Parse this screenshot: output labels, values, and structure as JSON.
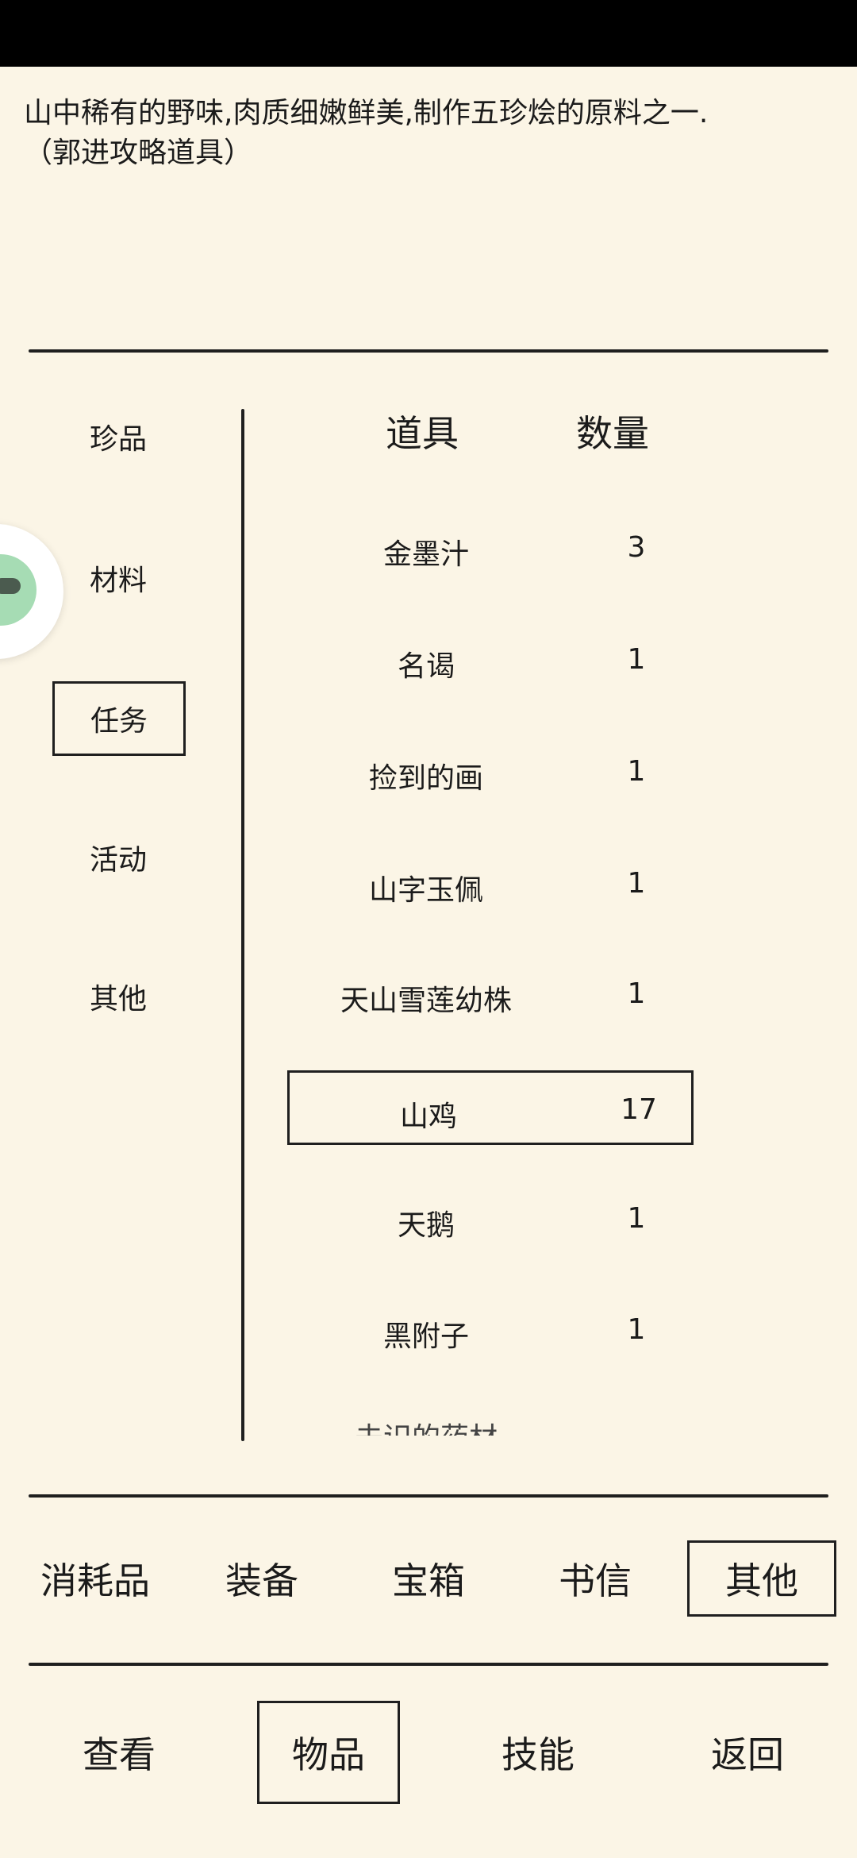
{
  "description": {
    "line1": "山中稀有的野味,肉质细嫩鲜美,制作五珍烩的原料之一.",
    "line2": "（郭进攻略道具）"
  },
  "categories": [
    {
      "label": "珍品",
      "active": false
    },
    {
      "label": "材料",
      "active": false
    },
    {
      "label": "任务",
      "active": true
    },
    {
      "label": "活动",
      "active": false
    },
    {
      "label": "其他",
      "active": false
    }
  ],
  "table": {
    "header_item": "道具",
    "header_qty": "数量",
    "rows": [
      {
        "name": "金墨汁",
        "qty": "3"
      },
      {
        "name": "名谒",
        "qty": "1"
      },
      {
        "name": "捡到的画",
        "qty": "1"
      },
      {
        "name": "山字玉佩",
        "qty": "1"
      },
      {
        "name": "天山雪莲幼株",
        "qty": "1"
      },
      {
        "name": "山鸡",
        "qty": "17"
      },
      {
        "name": "天鹅",
        "qty": "1"
      },
      {
        "name": "黑附子",
        "qty": "1"
      }
    ],
    "selected_row": "山鸡",
    "partial_row": "未识的药材"
  },
  "tabs": [
    {
      "label": "消耗品"
    },
    {
      "label": "装备"
    },
    {
      "label": "宝箱"
    },
    {
      "label": "书信"
    },
    {
      "label": "其他"
    }
  ],
  "nav": [
    {
      "label": "查看"
    },
    {
      "label": "物品"
    },
    {
      "label": "技能"
    },
    {
      "label": "返回"
    }
  ],
  "floating_button": {
    "icon": "assistant-ball-icon",
    "color": "#a6dcb4"
  }
}
